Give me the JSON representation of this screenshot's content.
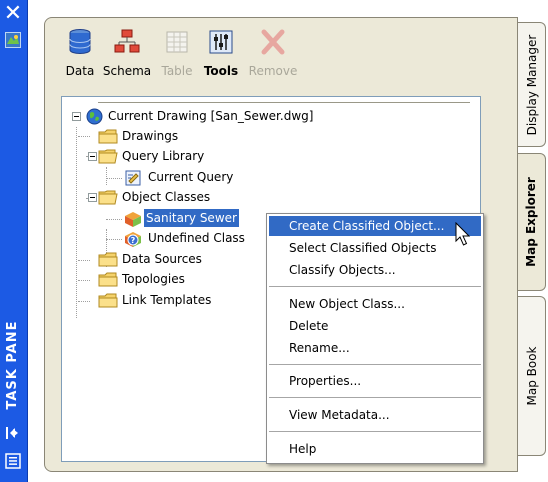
{
  "taskpane": {
    "title": "TASK PANE"
  },
  "toolbar": {
    "buttons": [
      {
        "label": "Data",
        "enabled": true
      },
      {
        "label": "Schema",
        "enabled": true
      },
      {
        "label": "Table",
        "enabled": false
      },
      {
        "label": "Tools",
        "enabled": true
      },
      {
        "label": "Remove",
        "enabled": false
      }
    ]
  },
  "tree": {
    "root": "Current Drawing [San_Sewer.dwg]",
    "items": {
      "drawings": "Drawings",
      "query_library": "Query Library",
      "current_query": "Current Query",
      "object_classes": "Object Classes",
      "sanitary_sewer": "Sanitary Sewer",
      "undefined_class": "Undefined Class",
      "data_sources": "Data Sources",
      "topologies": "Topologies",
      "link_templates": "Link Templates"
    }
  },
  "tabs": {
    "display_manager": "Display Manager",
    "map_explorer": "Map Explorer",
    "map_book": "Map Book"
  },
  "context_menu": {
    "create_classified": "Create Classified Object...",
    "select_classified": "Select Classified Objects",
    "classify_objects": "Classify Objects...",
    "new_object_class": "New Object Class...",
    "delete": "Delete",
    "rename": "Rename...",
    "properties": "Properties...",
    "view_metadata": "View Metadata...",
    "help": "Help"
  },
  "colors": {
    "strip": "#1c5ae4",
    "selection": "#316ac5",
    "panel": "#ece9d8"
  }
}
